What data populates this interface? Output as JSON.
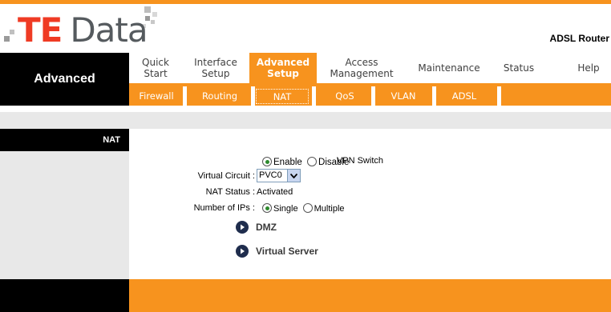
{
  "header": {
    "logo": {
      "te": "TE",
      "data": "Data"
    },
    "product_name": "ADSL Router"
  },
  "section_title": "Advanced",
  "main_menu": [
    {
      "label": "Quick\nStart"
    },
    {
      "label": "Interface\nSetup"
    },
    {
      "label": "Advanced\nSetup",
      "active": true
    },
    {
      "label": "Access\nManagement"
    },
    {
      "label": "Maintenance"
    },
    {
      "label": "Status"
    },
    {
      "label": "Help"
    }
  ],
  "sub_menu": [
    {
      "label": "Firewall"
    },
    {
      "label": "Routing"
    },
    {
      "label": "NAT",
      "active": true
    },
    {
      "label": "QoS"
    },
    {
      "label": "VLAN"
    },
    {
      "label": "ADSL"
    }
  ],
  "sidebar": {
    "label": "NAT"
  },
  "form": {
    "vpn_switch": {
      "label": "VPN Switch",
      "options": [
        "Enable",
        "Disable"
      ],
      "selected": "Enable"
    },
    "virtual_circuit": {
      "label": "Virtual Circuit :",
      "value": "PVC0"
    },
    "nat_status": {
      "label": "NAT Status :",
      "value": "Activated"
    },
    "number_of_ips": {
      "label": "Number of IPs :",
      "options": [
        "Single",
        "Multiple"
      ],
      "selected": "Single"
    }
  },
  "links": [
    {
      "label": "DMZ"
    },
    {
      "label": "Virtual Server"
    }
  ],
  "colors": {
    "accent": "#f7931e",
    "dark": "#000000",
    "logo_red": "#ef3b24",
    "logo_gray": "#555a5e"
  }
}
